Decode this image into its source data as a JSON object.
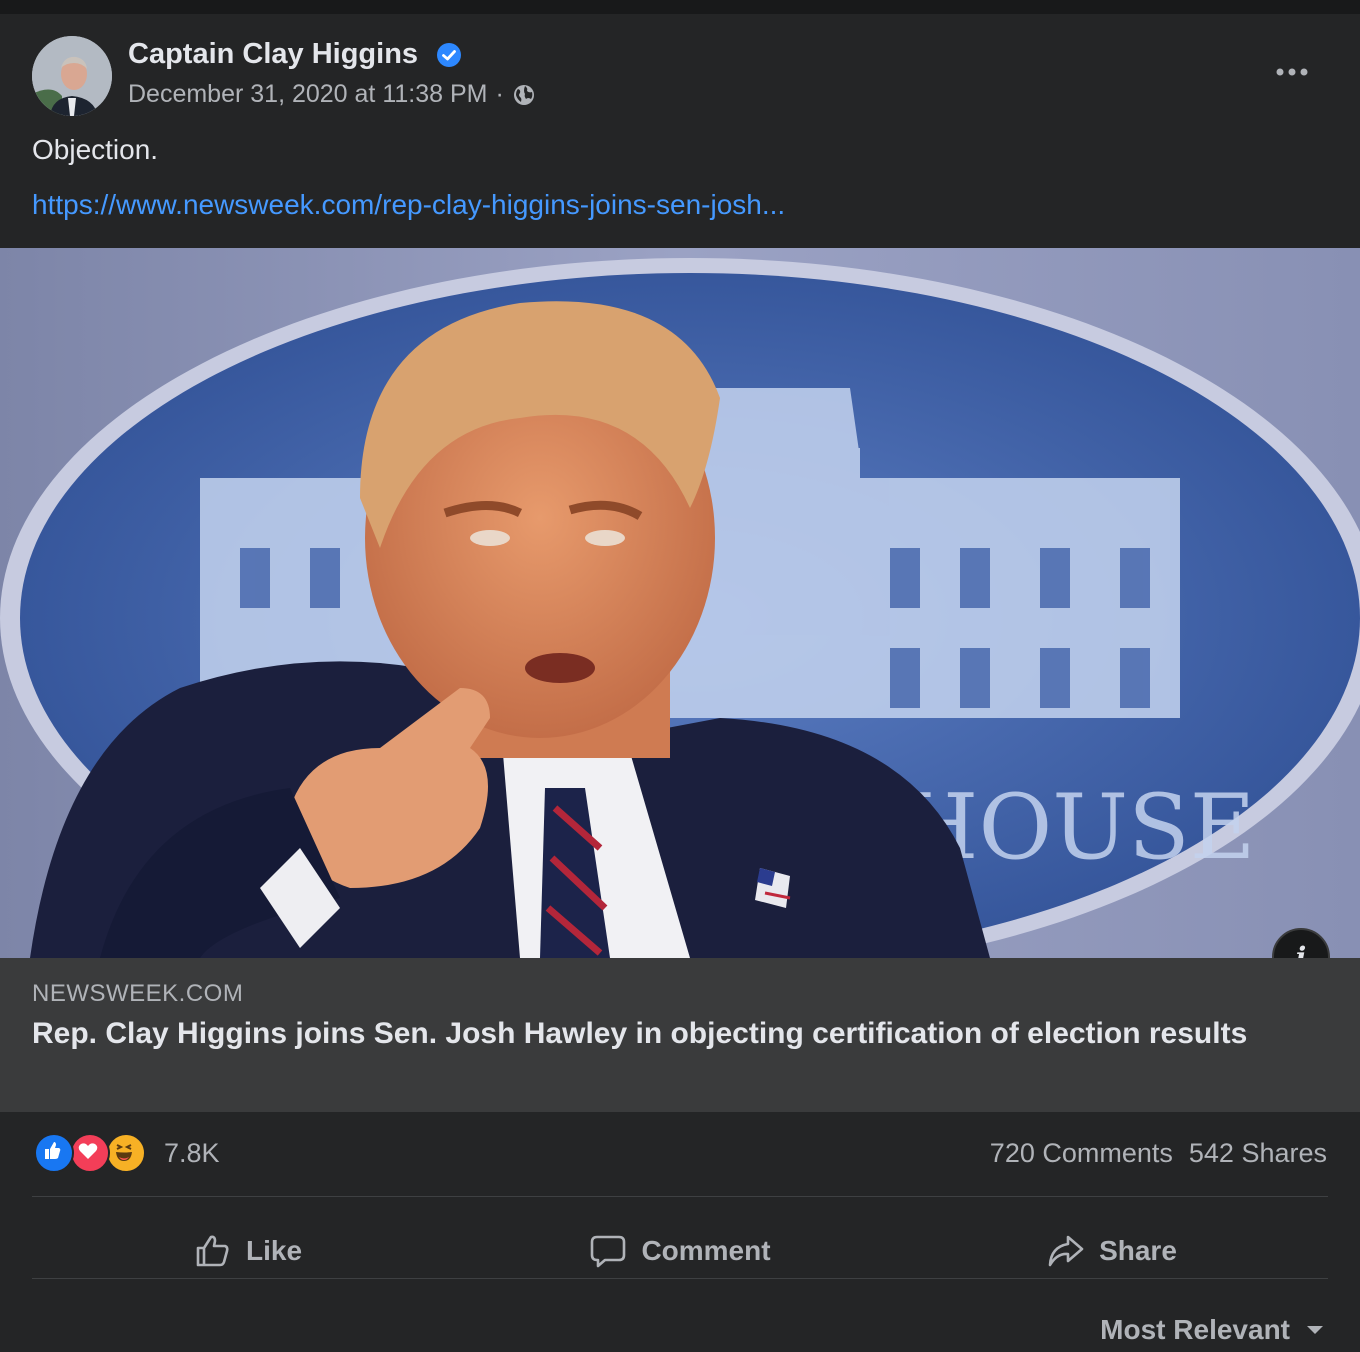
{
  "post": {
    "author": "Captain Clay Higgins",
    "timestamp": "December 31, 2020 at 11:38 PM",
    "separator": "·",
    "audience_icon": "globe-icon",
    "verified_icon": "verified-badge-icon",
    "more_icon": "more-options-icon",
    "text": "Objection.",
    "link": "https://www.newsweek.com/rep-clay-higgins-joins-sen-josh..."
  },
  "link_preview": {
    "image_sign_text": "HOUSE",
    "domain": "NEWSWEEK.COM",
    "headline": "Rep. Clay Higgins joins Sen. Josh Hawley in objecting certification of election results",
    "info_icon": "i"
  },
  "engagement": {
    "reaction_icons": [
      "like-reaction-icon",
      "love-reaction-icon",
      "haha-reaction-icon"
    ],
    "reactions_count": "7.8K",
    "comments": "720 Comments",
    "shares": "542 Shares"
  },
  "actions": {
    "like": "Like",
    "comment": "Comment",
    "share": "Share"
  },
  "comments_sort": {
    "label": "Most Relevant"
  },
  "colors": {
    "background": "#242526",
    "preview_background": "#3a3b3c",
    "link": "#4599ff",
    "verified": "#2d88ff",
    "like": "#1877f2",
    "love": "#f33e58",
    "haha": "#f7b125"
  }
}
